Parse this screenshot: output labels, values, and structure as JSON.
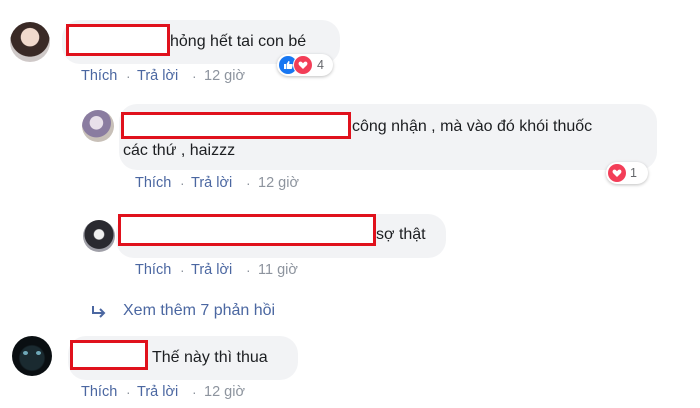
{
  "comments": [
    {
      "text": "hỏng hết tai con bé",
      "actions": {
        "like": "Thích",
        "reply": "Trả lời",
        "time": "12 giờ"
      },
      "reaction_count": "4"
    },
    {
      "text_line1": "công nhận , mà vào đó khói thuốc",
      "text_line2": "các thứ , haizzz",
      "actions": {
        "like": "Thích",
        "reply": "Trả lời",
        "time": "12 giờ"
      },
      "reaction_count": "1"
    },
    {
      "text": "sợ thật",
      "actions": {
        "like": "Thích",
        "reply": "Trả lời",
        "time": "11 giờ"
      }
    },
    {
      "text": "Thế này thì thua",
      "actions": {
        "like": "Thích",
        "reply": "Trả lời",
        "time": "12 giờ"
      }
    }
  ],
  "view_more": {
    "label": "Xem thêm 7 phản hồi",
    "icon": "reply-arrow-icon"
  },
  "colors": {
    "link_blue": "#4b67a1",
    "bubble_bg": "#f2f3f5",
    "redaction_red": "#e0111c",
    "like_blue": "#1877f2",
    "love_red": "#f33e58"
  }
}
